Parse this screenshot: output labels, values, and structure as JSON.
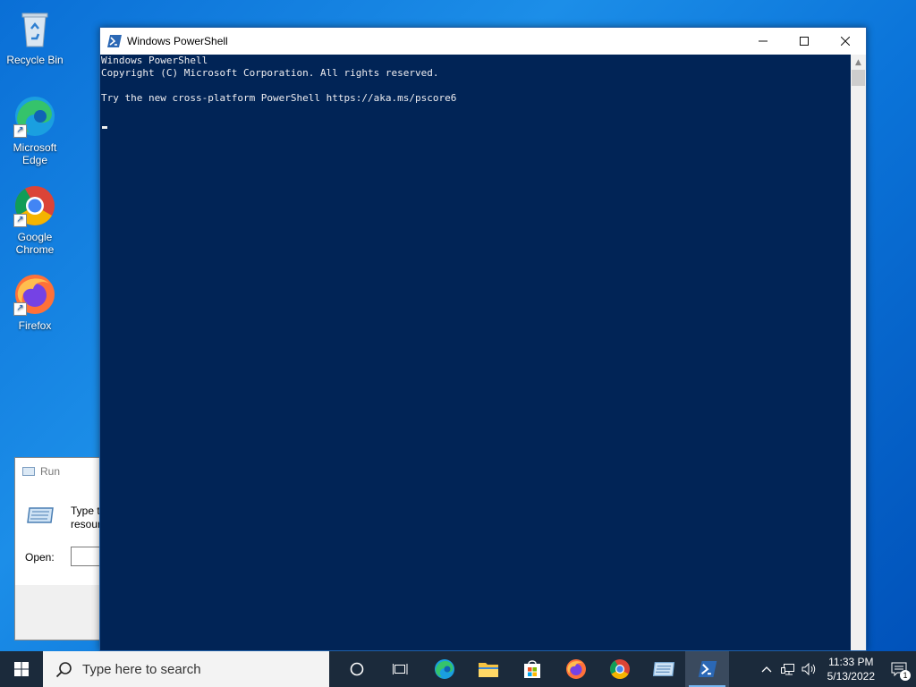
{
  "desktop": {
    "icons": [
      {
        "label": "Recycle Bin",
        "icon": "recycle-bin-icon"
      },
      {
        "label": "Microsoft Edge",
        "icon": "edge-icon"
      },
      {
        "label": "Google Chrome",
        "icon": "chrome-icon"
      },
      {
        "label": "Firefox",
        "icon": "firefox-icon"
      }
    ]
  },
  "run_dialog": {
    "title": "Run",
    "description_line1": "Type t",
    "description_line2": "resour",
    "open_label": "Open:",
    "open_value": ""
  },
  "powershell": {
    "title": "Windows PowerShell",
    "lines": [
      "Windows PowerShell",
      "Copyright (C) Microsoft Corporation. All rights reserved.",
      "",
      "Try the new cross-platform PowerShell https://aka.ms/pscore6"
    ],
    "colors": {
      "background": "#012456",
      "text": "#eeedf0"
    }
  },
  "taskbar": {
    "search_placeholder": "Type here to search",
    "apps": [
      "cortana-icon",
      "task-view-icon",
      "edge-icon",
      "file-explorer-icon",
      "store-icon",
      "firefox-icon",
      "chrome-icon",
      "run-icon",
      "powershell-icon"
    ],
    "active_app": "powershell-icon",
    "clock_time": "11:33 PM",
    "clock_date": "5/13/2022",
    "notification_count": "1"
  }
}
